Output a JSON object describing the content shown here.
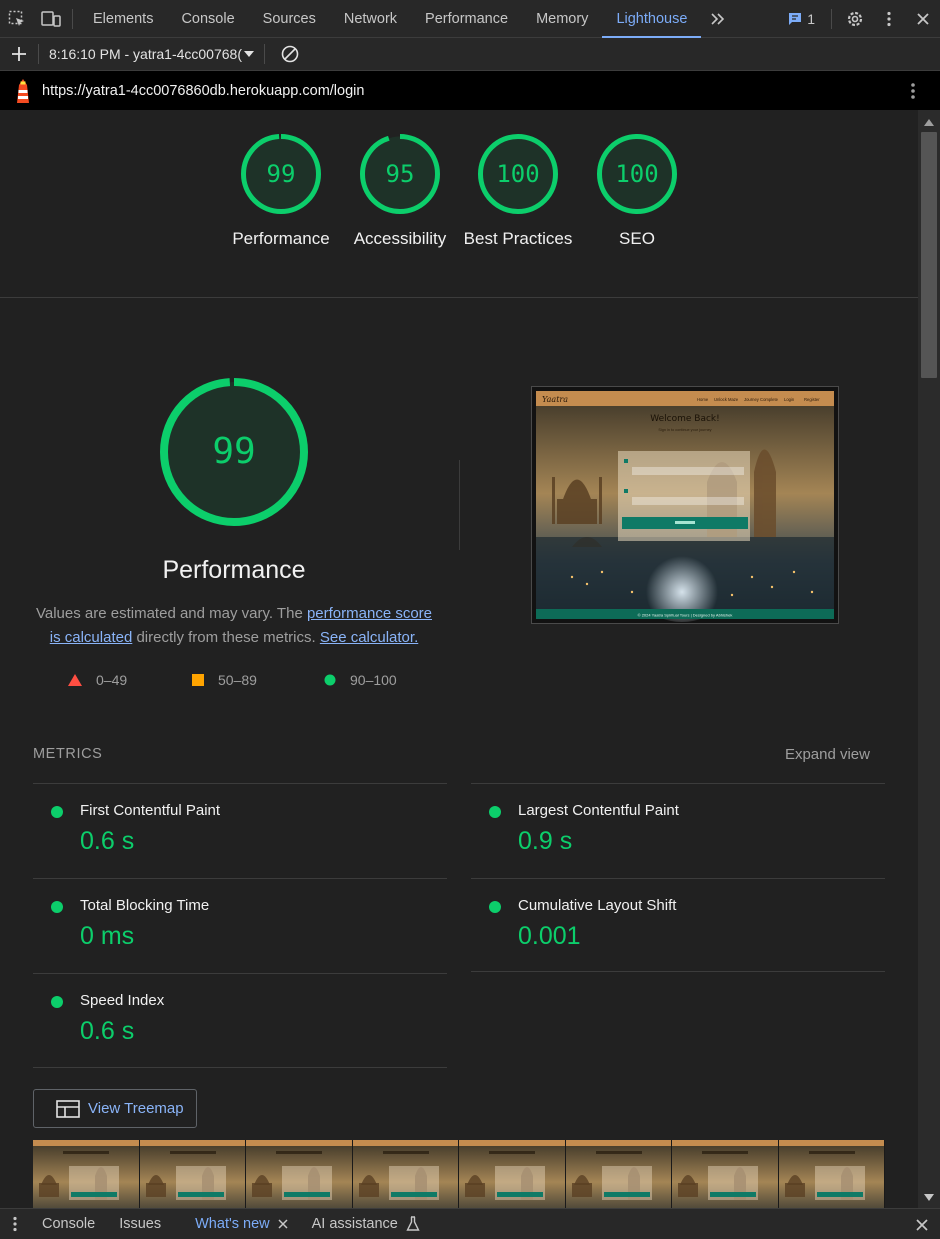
{
  "devtools": {
    "tabs": [
      {
        "label": "Elements"
      },
      {
        "label": "Console"
      },
      {
        "label": "Sources"
      },
      {
        "label": "Network"
      },
      {
        "label": "Performance"
      },
      {
        "label": "Memory"
      },
      {
        "label": "Lighthouse"
      }
    ],
    "active_tab": "Lighthouse",
    "issues_count": "1"
  },
  "toolbar": {
    "session": "8:16:10 PM - yatra1-4cc00768("
  },
  "report": {
    "url": "https://yatra1-4cc0076860db.herokuapp.com/login",
    "gauges": [
      {
        "score": "99",
        "label": "Performance",
        "value": 99
      },
      {
        "score": "95",
        "label": "Accessibility",
        "value": 95
      },
      {
        "score": "100",
        "label": "Best Practices",
        "value": 100
      },
      {
        "score": "100",
        "label": "SEO",
        "value": 100
      }
    ],
    "performance": {
      "score": "99",
      "value": 99,
      "title": "Performance",
      "desc_1": "Values are estimated and may vary. The ",
      "desc_link_1": "performance score is calculated",
      "desc_2": " directly from these metrics. ",
      "desc_link_2": "See calculator."
    },
    "legend": [
      {
        "range": "0–49",
        "color": "#ff4e42"
      },
      {
        "range": "50–89",
        "color": "#ffa400"
      },
      {
        "range": "90–100",
        "color": "#0cce6b"
      }
    ],
    "screenshot": {
      "brand": "Yaatra",
      "nav": [
        "Home",
        "Unlock Maze",
        "Journey Complete",
        "Login",
        "Register"
      ],
      "heading": "Welcome Back!",
      "sub": "Sign in to continue your journey",
      "footer": "© 2024 Yaatra Spiritual Tours | Designed by Abhishek"
    },
    "metrics_header": "METRICS",
    "expand_label": "Expand view",
    "metrics": [
      {
        "name": "First Contentful Paint",
        "value": "0.6 s"
      },
      {
        "name": "Largest Contentful Paint",
        "value": "0.9 s"
      },
      {
        "name": "Total Blocking Time",
        "value": "0 ms"
      },
      {
        "name": "Cumulative Layout Shift",
        "value": "0.001"
      },
      {
        "name": "Speed Index",
        "value": "0.6 s"
      }
    ],
    "treemap_label": "View Treemap",
    "filmstrip_frames": 8
  },
  "drawer": {
    "tabs": [
      {
        "label": "Console"
      },
      {
        "label": "Issues"
      },
      {
        "label": "What's new"
      },
      {
        "label": "AI assistance"
      }
    ],
    "active_tab": "What's new"
  },
  "colors": {
    "pass": "#0cce6b",
    "accent": "#7cacf8",
    "link": "#8ab4f8"
  }
}
